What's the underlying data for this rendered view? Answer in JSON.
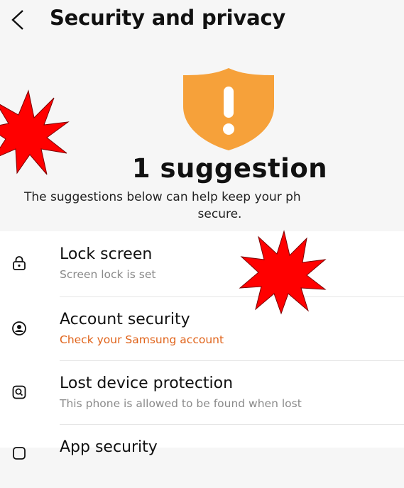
{
  "header": {
    "title": "Security and privacy"
  },
  "summary": {
    "title": "1 suggestion",
    "desc_line1": "The suggestions below can help keep your ph",
    "desc_line2": "secure."
  },
  "items": [
    {
      "title": "Lock screen",
      "subtitle": "Screen lock is set",
      "icon": "lock-icon"
    },
    {
      "title": "Account security",
      "subtitle": "Check your Samsung account",
      "icon": "account-icon"
    },
    {
      "title": "Lost device protection",
      "subtitle": "This phone is allowed to be found when lost",
      "icon": "find-device-icon"
    },
    {
      "title": "App security",
      "subtitle": "",
      "icon": "app-security-icon"
    }
  ],
  "colors": {
    "shield": "#f6a13a",
    "warning_text": "#e0631a",
    "burst": "#ff0000"
  }
}
